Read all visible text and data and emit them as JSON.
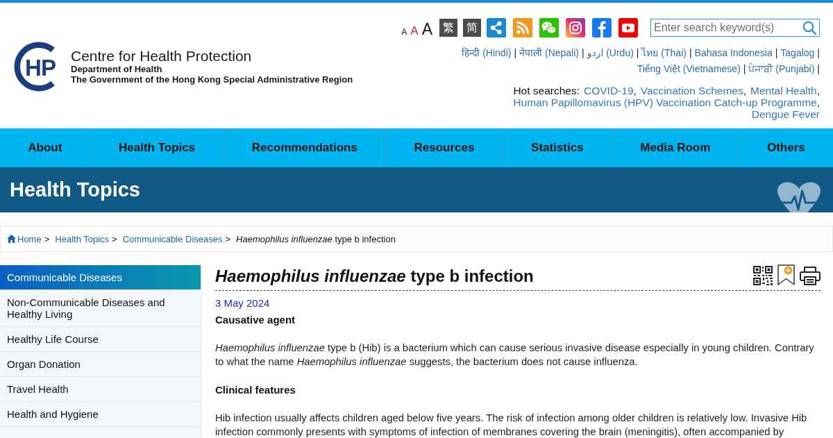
{
  "header": {
    "logo": {
      "mark": "HP",
      "title": "Centre for Health Protection",
      "department": "Department of Health",
      "government": "The Government of the Hong Kong Special Administrative Region"
    },
    "text_size": [
      {
        "label": "A",
        "kind": "small",
        "selected": false
      },
      {
        "label": "A",
        "kind": "medium",
        "selected": true
      },
      {
        "label": "A",
        "kind": "large",
        "selected": false
      }
    ],
    "script_buttons": [
      "繁",
      "简"
    ],
    "search": {
      "placeholder": "Enter search keyword(s)"
    },
    "language_rows": [
      [
        "हिन्दी (Hindi)",
        "नेपाली (Nepali)",
        "اردو (Urdu)",
        "ไทย (Thai)",
        "Bahasa Indonesia",
        "Tagalog"
      ],
      [
        "Tiếng Việt (Vietnamese)",
        "ਪੰਜਾਬੀ (Punjabi)"
      ]
    ],
    "language_separator": "|",
    "hot_searches": {
      "label": "Hot searches:",
      "rows": [
        [
          "COVID-19",
          "Vaccination Schemes",
          "Mental Health"
        ],
        [
          "Human Papillomavirus (HPV) Vaccination Catch-up Programme"
        ],
        [
          "Dengue Fever"
        ]
      ],
      "separator": ","
    }
  },
  "nav": [
    "About",
    "Health Topics",
    "Recommendations",
    "Resources",
    "Statistics",
    "Media Room",
    "Others"
  ],
  "banner": {
    "title": "Health Topics"
  },
  "breadcrumb": {
    "items": [
      {
        "label": "Home",
        "kind": "home"
      },
      {
        "label": "Health Topics",
        "kind": "link"
      },
      {
        "label": "Communicable Diseases",
        "kind": "link"
      },
      {
        "label": "*Haemophilus influenzae* type b infection",
        "kind": "current"
      }
    ],
    "separator": ">"
  },
  "sidebar": {
    "items": [
      {
        "label": "Communicable Diseases",
        "selected": true
      },
      {
        "label": "Non-Communicable Diseases and Healthy Living",
        "selected": false
      },
      {
        "label": "Healthy Life Course",
        "selected": false
      },
      {
        "label": "Organ Donation",
        "selected": false
      },
      {
        "label": "Travel Health",
        "selected": false
      },
      {
        "label": "Health and Hygiene",
        "selected": false
      }
    ]
  },
  "article": {
    "title": "*Haemophilus influenzae* type b infection",
    "date": "3 May 2024",
    "sections": [
      {
        "heading": "Causative agent",
        "paragraphs": [
          "*Haemophilus influenzae* type b (Hib) is a bacterium which can cause serious invasive disease especially in young children. Contrary to what the name *Haemophilus influenzae* suggests, the bacterium does not cause influenza."
        ]
      },
      {
        "heading": "Clinical features",
        "paragraphs": [
          "Hib infection usually affects children aged below five years. The risk of infection among older children is relatively low. Invasive Hib infection commonly presents with symptoms of infection of membranes covering the brain (meningitis), often accompanied by"
        ]
      }
    ]
  }
}
